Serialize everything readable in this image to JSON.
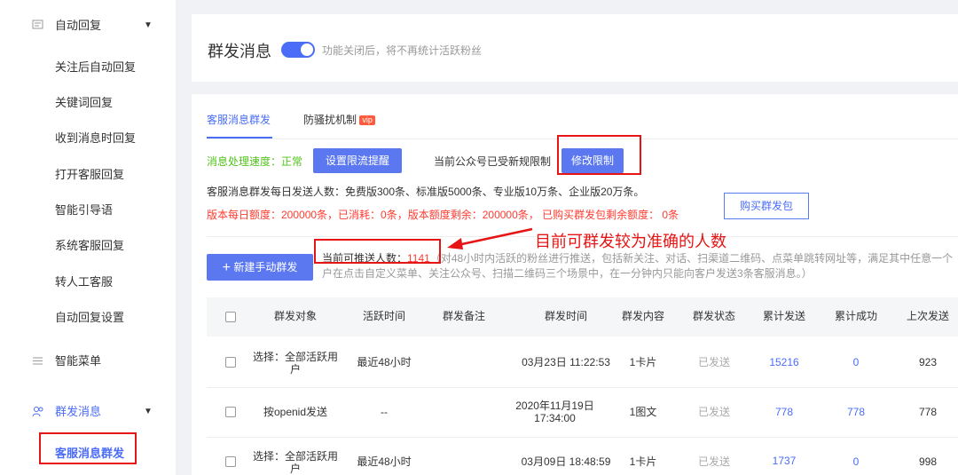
{
  "sidebar": {
    "group1": {
      "label": "自动回复"
    },
    "items": [
      {
        "label": "关注后自动回复"
      },
      {
        "label": "关键词回复"
      },
      {
        "label": "收到消息时回复"
      },
      {
        "label": "打开客服回复"
      },
      {
        "label": "智能引导语"
      },
      {
        "label": "系统客服回复"
      },
      {
        "label": "转人工客服"
      },
      {
        "label": "自动回复设置"
      }
    ],
    "menu": {
      "label": "智能菜单"
    },
    "group2": {
      "label": "群发消息"
    },
    "active_item": {
      "label": "客服消息群发"
    }
  },
  "header": {
    "title": "群发消息",
    "toggle_hint": "功能关闭后，将不再统计活跃粉丝",
    "toggle_on": true
  },
  "tabs": [
    {
      "label": "客服消息群发",
      "active": true
    },
    {
      "label": "防骚扰机制",
      "badge": "vip"
    }
  ],
  "status": {
    "speed_label": "消息处理速度：正常",
    "set_alert_btn": "设置限流提醒",
    "restriction_text": "当前公众号已受新规限制",
    "modify_btn": "修改限制",
    "daily_limits": "客服消息群发每日发送人数：免费版300条、标准版5000条、专业版10万条、企业版20万条。",
    "quota_line": "版本每日额度：200000条，已消耗：0条，版本额度剩余：200000条， 已购买群发包剩余额度： 0条",
    "buy_btn": "购买群发包"
  },
  "new_btn": "新建手动群发",
  "sendable": {
    "label": "当前可推送人数：",
    "count": "1141",
    "desc_line1": "（对48小时内活跃的粉丝进行推送，包括新关注、对话、扫渠道二维码、点菜单跳转网址等，满足其中任意一个",
    "desc_line2": "户在点击自定义菜单、关注公众号、扫描二维码三个场景中，在一分钟内只能向客户发送3条客服消息。）"
  },
  "annotation": "目前可群发较为准确的人数",
  "table": {
    "headers": [
      "群发对象",
      "活跃时间",
      "群发备注",
      "群发时间",
      "群发内容",
      "群发状态",
      "累计发送",
      "累计成功",
      "上次发送"
    ],
    "rows": [
      {
        "target": "选择：全部活跃用户",
        "active": "最近48小时",
        "note": "",
        "time": "03月23日 11:22:53",
        "content": "1卡片",
        "status": "已发送",
        "sent": "15216",
        "success": "0",
        "last": "923"
      },
      {
        "target": "按openid发送",
        "active": "--",
        "note": "",
        "time": "2020年11月19日 17:34:00",
        "content": "1图文",
        "status": "已发送",
        "sent": "778",
        "success": "778",
        "last": "778"
      },
      {
        "target": "选择：全部活跃用户",
        "active": "最近48小时",
        "note": "",
        "time": "03月09日 18:48:59",
        "content": "1卡片",
        "status": "已发送",
        "sent": "1737",
        "success": "0",
        "last": "998"
      }
    ]
  }
}
